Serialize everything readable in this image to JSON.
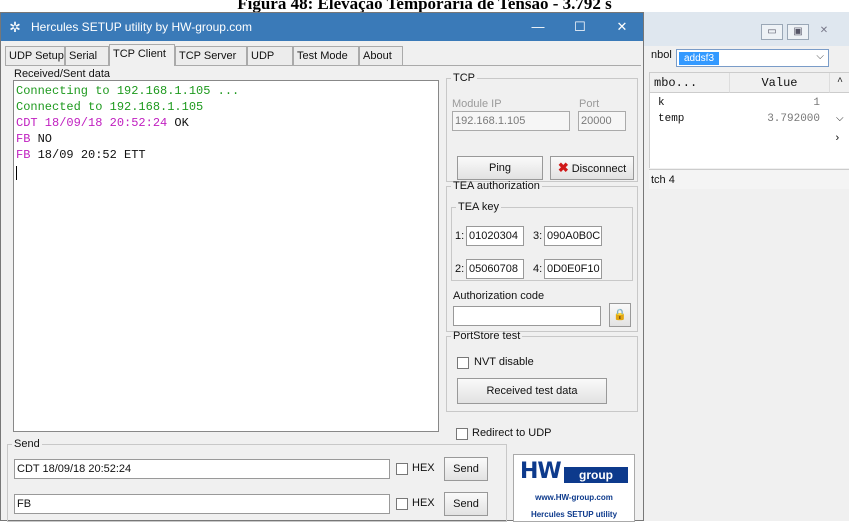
{
  "caption": "Figura 48: Elevação Temporária de Tensão - 3.792 s",
  "bg_window": {
    "symbol_label": "nbol",
    "symbol_value": "addsf3",
    "col_symbol": "mbo...",
    "col_value": "Value",
    "rows": [
      {
        "symbol": "k",
        "value": "1"
      },
      {
        "symbol": "temp",
        "value": "3.792000"
      }
    ],
    "tab_label": "tch 4"
  },
  "window": {
    "title": "Hercules SETUP utility by HW-group.com",
    "minimize": "—",
    "maximize": "☐",
    "close": "✕"
  },
  "tabs": [
    "UDP Setup",
    "Serial",
    "TCP Client",
    "TCP Server",
    "UDP",
    "Test Mode",
    "About"
  ],
  "received_label": "Received/Sent data",
  "terminal": {
    "lines": [
      {
        "text": "Connecting to 192.168.1.105 ...",
        "prefix": ""
      },
      {
        "text": "Connected to 192.168.1.105",
        "prefix": ""
      },
      {
        "text": "CDT 18/09/18 20:52:24",
        "prefix": "",
        "suffix": " OK"
      },
      {
        "prefix": "FB",
        "text": " NO"
      },
      {
        "prefix": "FB",
        "text": " 18/09 20:52 ETT"
      }
    ]
  },
  "tcp": {
    "legend": "TCP",
    "module_ip_label": "Module IP",
    "port_label": "Port",
    "module_ip": "192.168.1.105",
    "port": "20000",
    "ping": "Ping",
    "disconnect": "Disconnect"
  },
  "tea": {
    "legend": "TEA authorization",
    "key_legend": "TEA key",
    "keys": [
      {
        "n": "1:",
        "v": "01020304"
      },
      {
        "n": "3:",
        "v": "090A0B0C"
      },
      {
        "n": "2:",
        "v": "05060708"
      },
      {
        "n": "4:",
        "v": "0D0E0F10"
      }
    ],
    "auth_label": "Authorization code",
    "auth_value": ""
  },
  "portstore": {
    "legend": "PortStore test",
    "nvt_label": "NVT disable",
    "received_test": "Received test data"
  },
  "redirect_label": "Redirect to UDP",
  "send": {
    "legend": "Send",
    "rows": [
      {
        "value": "CDT 18/09/18 20:52:24",
        "hex": "HEX",
        "button": "Send"
      },
      {
        "value": "FB",
        "hex": "HEX",
        "button": "Send"
      }
    ]
  },
  "logo": {
    "hw": "HW",
    "group": "group",
    "url": "www.HW-group.com",
    "product": "Hercules SETUP utility"
  },
  "colors": {
    "title_bar": "#3a7ab8",
    "green_text": "#1e9a1e",
    "purple_text": "#c020c0",
    "logo_blue": "#0d3a8c"
  }
}
